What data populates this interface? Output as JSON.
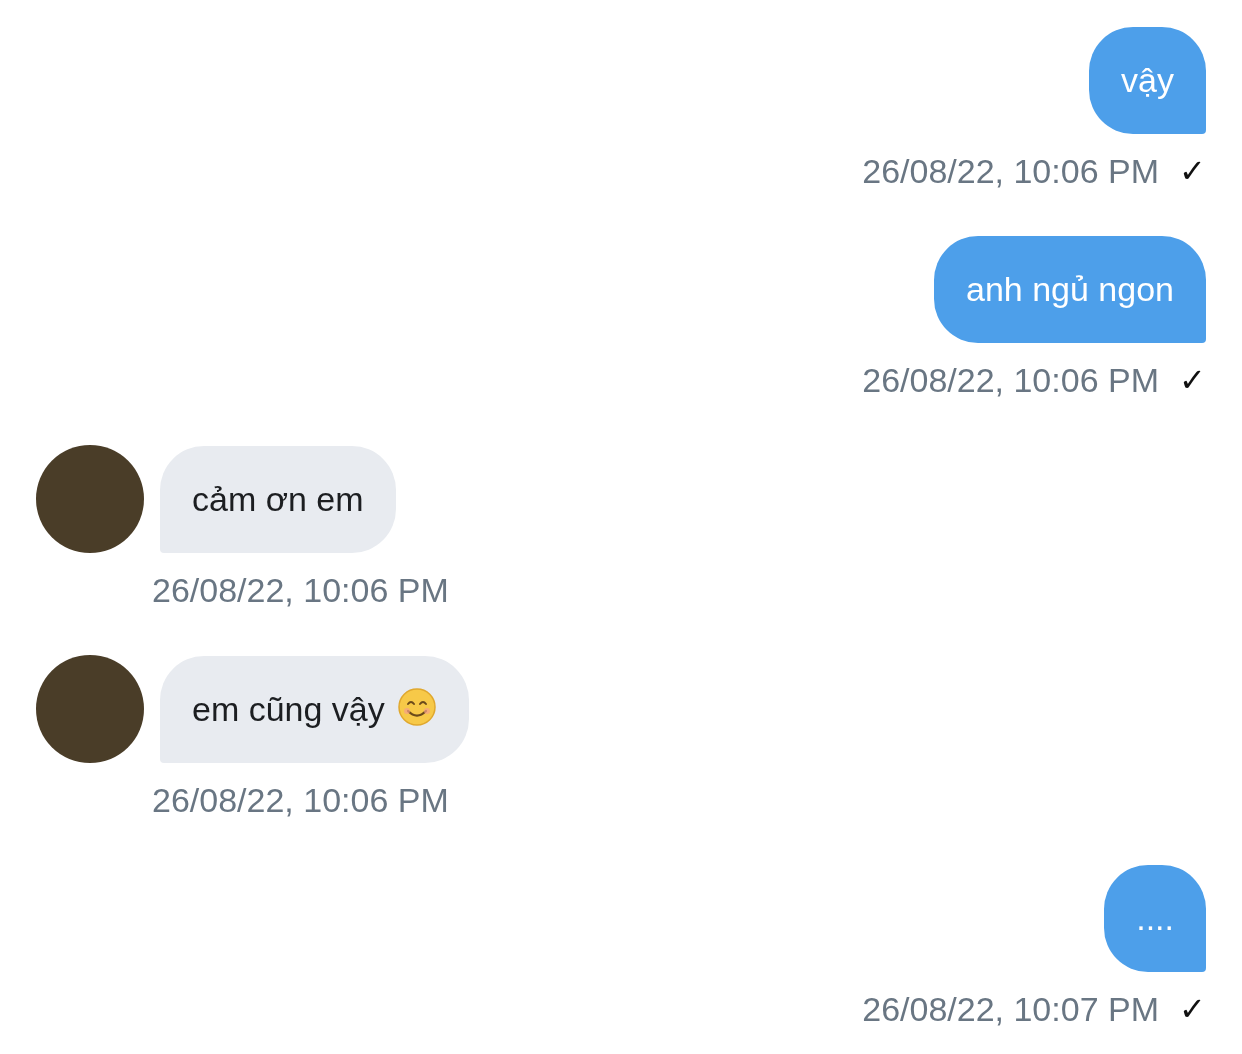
{
  "messages": [
    {
      "kind": "outgoing",
      "text": "vậy",
      "time": "26/08/22, 10:06 PM",
      "status_mark": "✓"
    },
    {
      "kind": "outgoing",
      "text": "anh ngủ ngon",
      "time": "26/08/22, 10:06 PM",
      "status_mark": "✓"
    },
    {
      "kind": "incoming",
      "text": "cảm ơn em",
      "time": "26/08/22, 10:06 PM"
    },
    {
      "kind": "incoming",
      "text": "em cũng vậy",
      "emoji": true,
      "time": "26/08/22, 10:06 PM"
    },
    {
      "kind": "outgoing",
      "text": "....",
      "time": "26/08/22, 10:07 PM",
      "status_mark": "✓"
    }
  ]
}
